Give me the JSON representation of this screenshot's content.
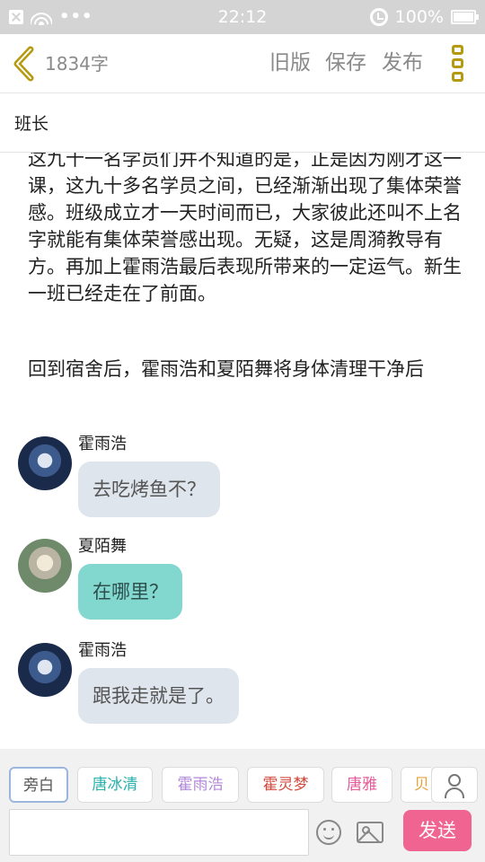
{
  "status_bar": {
    "time": "22:12",
    "battery": "100%",
    "dots": "•••"
  },
  "nav": {
    "word_count": "1834字",
    "old_version": "旧版",
    "save": "保存",
    "publish": "发布"
  },
  "title": "班长",
  "content": {
    "paragraphs": [
      "这九十一名学员们并不知道的是，正是因为刚才这一课，这九十多名学员之间，已经渐渐出现了集体荣誉感。班级成立才一天时间而已，大家彼此还叫不上名字就能有集体荣誉感出现。无疑，这是周漪教导有方。再加上霍雨浩最后表现所带来的一定运气。新生一班已经走在了前面。",
      "回到宿舍后，霍雨浩和夏陌舞将身体清理干净后"
    ],
    "messages": [
      {
        "name": "霍雨浩",
        "text": "去吃烤鱼不？"
      },
      {
        "name": "夏陌舞",
        "text": "在哪里？"
      },
      {
        "name": "霍雨浩",
        "text": "跟我走就是了。"
      }
    ]
  },
  "characters": [
    "旁白",
    "唐冰清",
    "霍雨浩",
    "霍灵梦",
    "唐雅",
    "贝"
  ],
  "input": {
    "value": "",
    "placeholder": ""
  },
  "send_label": "发送",
  "colors": {
    "accent": "#f06492",
    "back_arrow": "#b59a10",
    "bubble_grey": "#dfe5ec",
    "bubble_teal": "#82d7cf"
  }
}
